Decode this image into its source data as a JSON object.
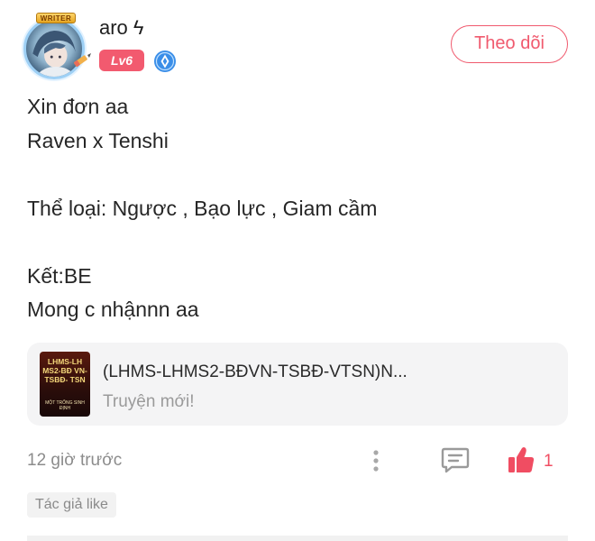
{
  "author": {
    "name": "aro ϟ",
    "badge": "WRITER",
    "level": "Lv6",
    "follow_label": "Theo dõi"
  },
  "post": {
    "lines": [
      "Xin đơn aa",
      "Raven x Tenshi",
      "",
      "Thể loại: Ngược , Bạo lực , Giam cầm",
      "",
      "Kết:BE",
      "Mong c nhậnnn aa"
    ]
  },
  "story_card": {
    "cover_text": "LHMS-LH MS2-BĐ VN-TSBĐ- TSN",
    "cover_sub": "MỘT TRỐNG SINH ĐỊNH",
    "title": "(LHMS-LHMS2-BĐVN-TSBĐ-VTSN)N...",
    "subtitle": "Truyện mới!"
  },
  "footer": {
    "timestamp": "12 giờ trước",
    "like_count": "1",
    "author_like_tag": "Tác giả like"
  },
  "colors": {
    "accent": "#f05a6e",
    "level_badge": "#f25a6f",
    "verified": "#3a8ee8",
    "card_bg": "#f4f4f5"
  },
  "icons": {
    "more": "more-vertical-icon",
    "comment": "comment-icon",
    "like": "thumbs-up-icon",
    "verified": "verified-icon",
    "pen": "pen-icon"
  }
}
